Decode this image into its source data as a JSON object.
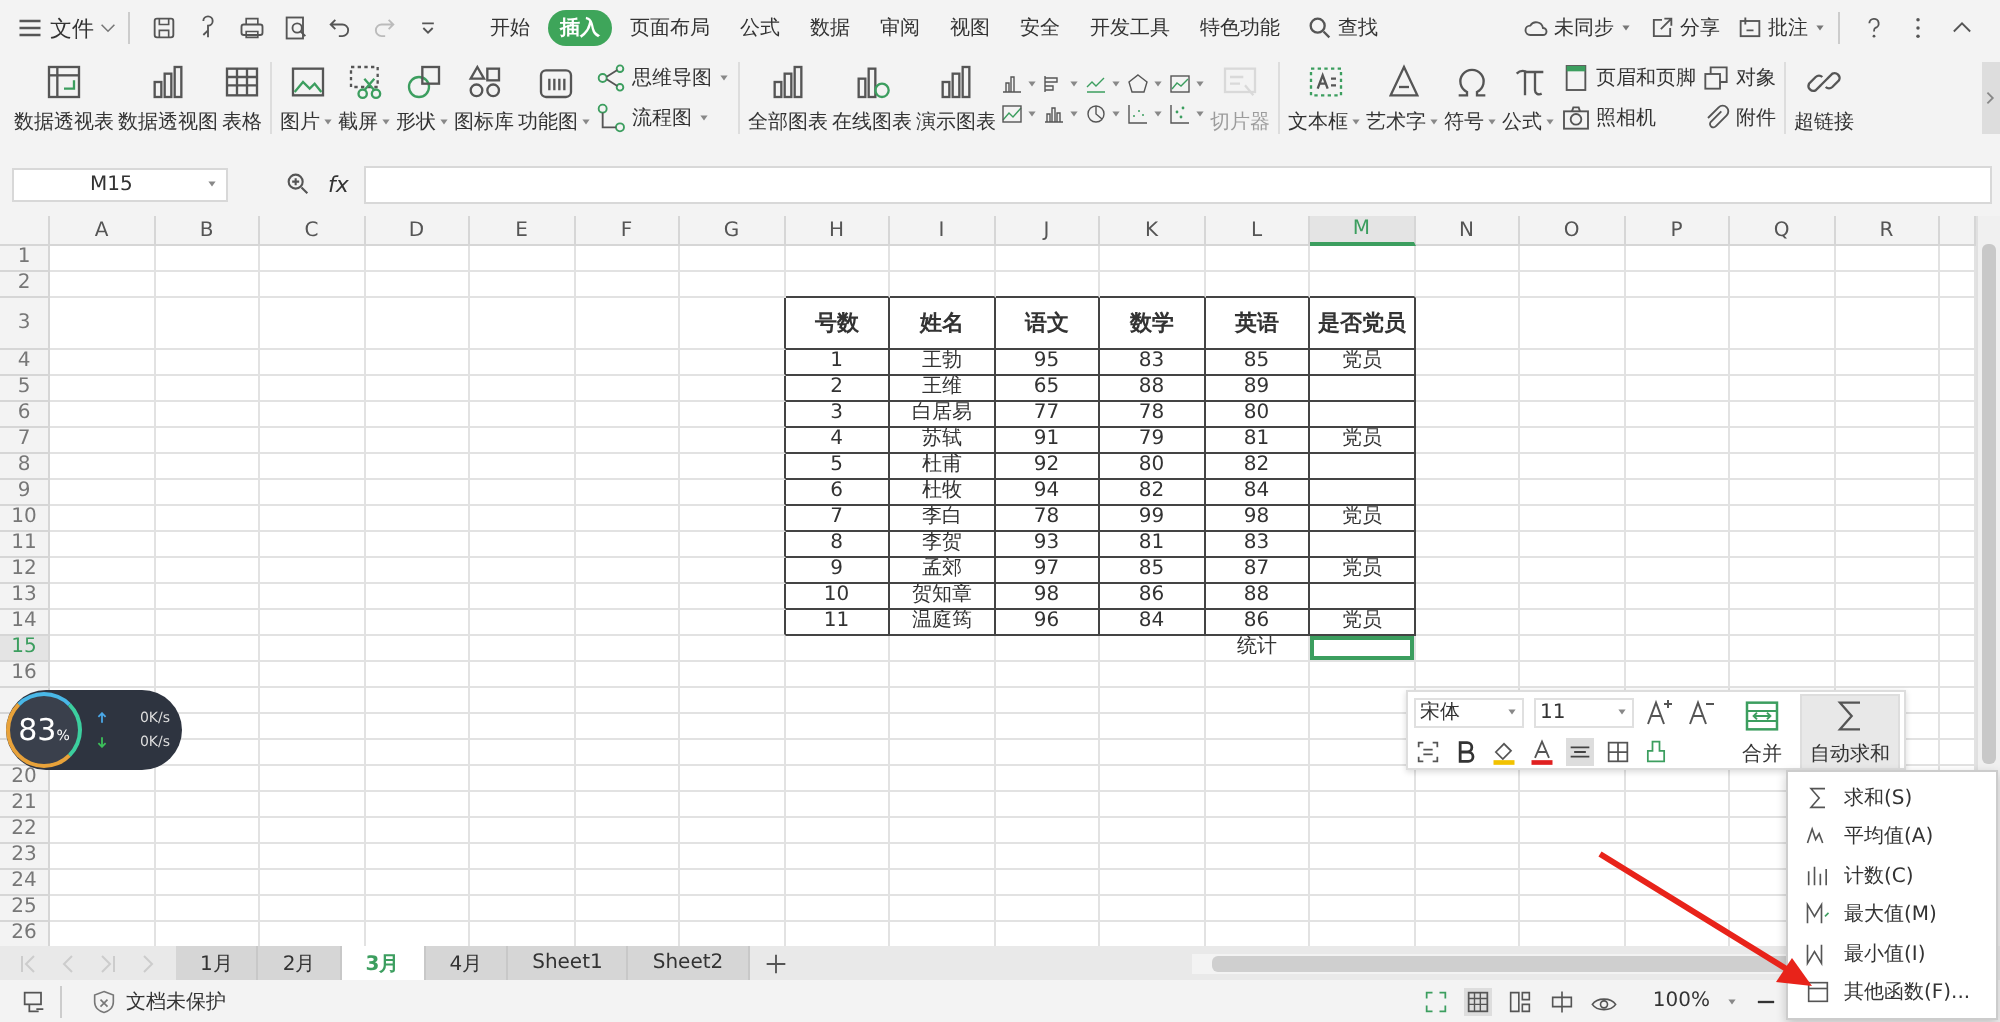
{
  "menu_bar": {
    "file": "文件",
    "tabs": [
      {
        "label": "开始",
        "selected": false
      },
      {
        "label": "插入",
        "selected": true
      },
      {
        "label": "页面布局",
        "selected": false
      },
      {
        "label": "公式",
        "selected": false
      },
      {
        "label": "数据",
        "selected": false
      },
      {
        "label": "审阅",
        "selected": false
      },
      {
        "label": "视图",
        "selected": false
      },
      {
        "label": "安全",
        "selected": false
      },
      {
        "label": "开发工具",
        "selected": false
      },
      {
        "label": "特色功能",
        "selected": false
      }
    ],
    "search": "查找",
    "sync": "未同步",
    "share": "分享",
    "comment": "批注"
  },
  "ribbon": {
    "groups": [
      {
        "items": [
          {
            "kind": "large",
            "label": "数据透视表",
            "dropdown": false,
            "disabled": false
          },
          {
            "kind": "large",
            "label": "数据透视图",
            "dropdown": false,
            "disabled": false
          },
          {
            "kind": "large",
            "label": "表格",
            "dropdown": false,
            "disabled": false
          }
        ]
      },
      {
        "items": [
          {
            "kind": "large",
            "label": "图片",
            "dropdown": true,
            "disabled": false
          },
          {
            "kind": "large",
            "label": "截屏",
            "dropdown": true,
            "disabled": false
          },
          {
            "kind": "large",
            "label": "形状",
            "dropdown": true,
            "disabled": false
          },
          {
            "kind": "large",
            "label": "图标库",
            "dropdown": false,
            "disabled": false
          },
          {
            "kind": "large",
            "label": "功能图",
            "dropdown": true,
            "disabled": false
          },
          {
            "kind": "stack",
            "entries": [
              {
                "label": "思维导图",
                "dropdown": true
              },
              {
                "label": "流程图",
                "dropdown": true
              }
            ]
          }
        ]
      },
      {
        "items": [
          {
            "kind": "large",
            "label": "全部图表",
            "dropdown": false,
            "disabled": false
          },
          {
            "kind": "large",
            "label": "在线图表",
            "dropdown": false,
            "disabled": false
          },
          {
            "kind": "large",
            "label": "演示图表",
            "dropdown": false,
            "disabled": false
          },
          {
            "kind": "charts"
          },
          {
            "kind": "large",
            "label": "切片器",
            "dropdown": false,
            "disabled": true
          }
        ]
      },
      {
        "items": [
          {
            "kind": "large",
            "label": "文本框",
            "dropdown": true,
            "disabled": false
          },
          {
            "kind": "large",
            "label": "艺术字",
            "dropdown": true,
            "disabled": false
          },
          {
            "kind": "large",
            "label": "符号",
            "dropdown": true,
            "disabled": false
          },
          {
            "kind": "large",
            "label": "公式",
            "dropdown": true,
            "disabled": false
          },
          {
            "kind": "stack",
            "entries": [
              {
                "label": "页眉和页脚",
                "dropdown": false
              },
              {
                "label": "照相机",
                "dropdown": false
              }
            ]
          },
          {
            "kind": "stack",
            "entries": [
              {
                "label": "对象",
                "dropdown": false
              },
              {
                "label": "附件",
                "dropdown": false
              }
            ]
          }
        ]
      },
      {
        "items": [
          {
            "kind": "large",
            "label": "超链接",
            "dropdown": false,
            "disabled": false
          }
        ]
      }
    ]
  },
  "formula_bar": {
    "name_box": "M15",
    "fx": "fx"
  },
  "sheet": {
    "columns": [
      {
        "label": "A",
        "selected": false
      },
      {
        "label": "B",
        "selected": false
      },
      {
        "label": "C",
        "selected": false
      },
      {
        "label": "D",
        "selected": false
      },
      {
        "label": "E",
        "selected": false
      },
      {
        "label": "F",
        "selected": false
      },
      {
        "label": "G",
        "selected": false
      },
      {
        "label": "H",
        "selected": false
      },
      {
        "label": "I",
        "selected": false
      },
      {
        "label": "J",
        "selected": false
      },
      {
        "label": "K",
        "selected": false
      },
      {
        "label": "L",
        "selected": false
      },
      {
        "label": "M",
        "selected": true
      },
      {
        "label": "N",
        "selected": false
      },
      {
        "label": "O",
        "selected": false
      },
      {
        "label": "P",
        "selected": false
      },
      {
        "label": "Q",
        "selected": false
      },
      {
        "label": "R",
        "selected": false
      }
    ],
    "rows": [
      {
        "label": "1",
        "selected": false
      },
      {
        "label": "2",
        "selected": false
      },
      {
        "label": "3",
        "selected": false
      },
      {
        "label": "4",
        "selected": false
      },
      {
        "label": "5",
        "selected": false
      },
      {
        "label": "6",
        "selected": false
      },
      {
        "label": "7",
        "selected": false
      },
      {
        "label": "8",
        "selected": false
      },
      {
        "label": "9",
        "selected": false
      },
      {
        "label": "10",
        "selected": false
      },
      {
        "label": "11",
        "selected": false
      },
      {
        "label": "12",
        "selected": false
      },
      {
        "label": "13",
        "selected": false
      },
      {
        "label": "14",
        "selected": false
      },
      {
        "label": "15",
        "selected": true
      },
      {
        "label": "16",
        "selected": false
      },
      {},
      {},
      {},
      {
        "label": "20",
        "selected": false
      },
      {
        "label": "21",
        "selected": false
      },
      {
        "label": "22",
        "selected": false
      },
      {
        "label": "23",
        "selected": false
      },
      {
        "label": "24",
        "selected": false
      },
      {
        "label": "25",
        "selected": false
      },
      {
        "label": "26",
        "selected": false
      }
    ],
    "table": {
      "header": [
        "号数",
        "姓名",
        "语文",
        "数学",
        "英语",
        "是否党员"
      ],
      "rows": [
        [
          "1",
          "王勃",
          "95",
          "83",
          "85",
          "党员"
        ],
        [
          "2",
          "王维",
          "65",
          "88",
          "89",
          ""
        ],
        [
          "3",
          "白居易",
          "77",
          "78",
          "80",
          ""
        ],
        [
          "4",
          "苏轼",
          "91",
          "79",
          "81",
          "党员"
        ],
        [
          "5",
          "杜甫",
          "92",
          "80",
          "82",
          ""
        ],
        [
          "6",
          "杜牧",
          "94",
          "82",
          "84",
          ""
        ],
        [
          "7",
          "李白",
          "78",
          "99",
          "98",
          "党员"
        ],
        [
          "8",
          "李贺",
          "93",
          "81",
          "83",
          ""
        ],
        [
          "9",
          "孟郊",
          "97",
          "85",
          "87",
          "党员"
        ],
        [
          "10",
          "贺知章",
          "98",
          "86",
          "88",
          ""
        ],
        [
          "11",
          "温庭筠",
          "96",
          "84",
          "86",
          "党员"
        ]
      ],
      "total_label": "统计"
    }
  },
  "net_monitor": {
    "percent": "83",
    "unit": "%",
    "upload": "0K/s",
    "download": "0K/s"
  },
  "mini_toolbar": {
    "font": "宋体",
    "size": "11",
    "merge": "合并",
    "autosum": "自动求和"
  },
  "autosum_menu": [
    "求和(S)",
    "平均值(A)",
    "计数(C)",
    "最大值(M)",
    "最小值(I)",
    "其他函数(F)..."
  ],
  "sheet_tabs": [
    {
      "label": "1月",
      "selected": false
    },
    {
      "label": "2月",
      "selected": false
    },
    {
      "label": "3月",
      "selected": true
    },
    {
      "label": "4月",
      "selected": false
    },
    {
      "label": "Sheet1",
      "selected": false
    },
    {
      "label": "Sheet2",
      "selected": false
    }
  ],
  "status_bar": {
    "protection": "文档未保护",
    "zoom": "100%"
  }
}
